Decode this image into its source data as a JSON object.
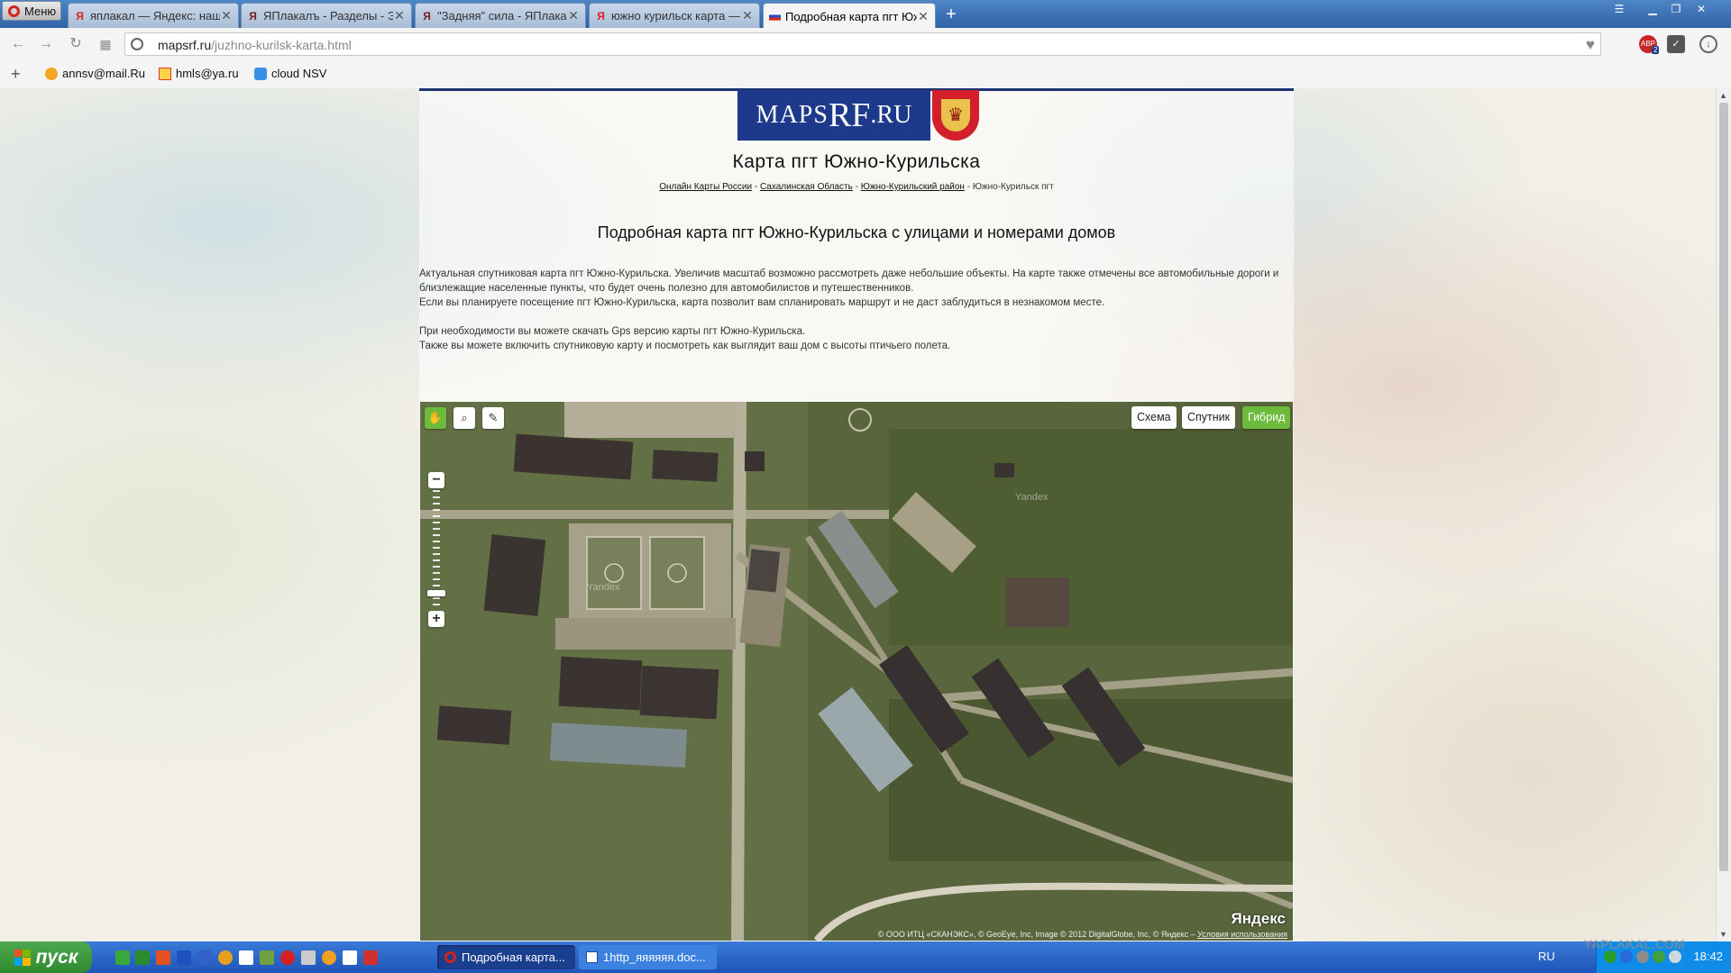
{
  "browser": {
    "menu_label": "Меню",
    "tabs": [
      {
        "label": "яплакал — Яндекс: наш",
        "icon": "yandex-icon"
      },
      {
        "label": "ЯПлакалъ - Разделы - Э",
        "icon": "yaplakal-icon"
      },
      {
        "label": "\"Задняя\" сила - ЯПлака",
        "icon": "yaplakal-icon"
      },
      {
        "label": "южно курильск карта —",
        "icon": "yandex-icon"
      },
      {
        "label": "Подробная карта пгт Юж",
        "icon": "russia-flag-icon"
      }
    ],
    "new_tab": "+",
    "url_host": "mapsrf.ru",
    "url_path": "/juzhno-kurilsk-karta.html",
    "bookmarks": [
      {
        "label": "annsv@mail.Ru",
        "icon": "mailru-icon"
      },
      {
        "label": "hmls@ya.ru",
        "icon": "mail-envelope-icon"
      },
      {
        "label": "cloud NSV",
        "icon": "cloud-icon"
      }
    ],
    "ext_badge": "2"
  },
  "page": {
    "logo": {
      "part1": "MAPS",
      "part2": "RF",
      "part3": ".RU"
    },
    "title": "Карта пгт Южно-Курильска",
    "breadcrumbs": [
      "Онлайн Карты России",
      "Сахалинская Область",
      "Южно-Курильский район",
      "Южно-Курильск пгт"
    ],
    "crumb_sep": " - ",
    "subtitle": "Подробная карта пгт Южно-Курильска с улицами и номерами домов",
    "paragraph1": "Актуальная спутниковая карта пгт Южно-Курильска. Увеличив масштаб возможно рассмотреть даже небольшие объекты. На карте также отмечены все автомобильные дороги и близлежащие населенные пункты, что будет очень полезно для автомобилистов и путешественников.",
    "paragraph2": "Если вы планируете посещение пгт Южно-Курильска, карта позволит вам спланировать маршрут и не даст заблудиться в незнакомом месте.",
    "paragraph3": "При необходимости вы можете скачать Gps версию карты пгт Южно-Курильска.",
    "paragraph4": "Также вы можете включить спутниковую карту и посмотреть как выглядит ваш дом с высоты птичьего полета."
  },
  "map": {
    "layers": [
      {
        "label": "Схема",
        "active": false
      },
      {
        "label": "Спутник",
        "active": false
      },
      {
        "label": "Гибрид",
        "active": true
      }
    ],
    "zoom_in": "+",
    "zoom_out": "−",
    "zoom_level": 0.11,
    "brand": "Яндекс",
    "watermark": "Yandex",
    "copyright": "© ООО ИТЦ «СКАНЭКС», © GeoEye, Inc, Image © 2012 DigitalGlobe, Inc, © Яндекс – ",
    "terms_link": "Условия использования"
  },
  "taskbar": {
    "start_label": "пуск",
    "tasks": [
      {
        "label": "Подробная карта...",
        "active": true
      },
      {
        "label": "1http_яяяяяя.doc...",
        "active": false
      }
    ],
    "lang": "RU",
    "clock": "18:42"
  },
  "watermark_site": "YAPLAKAL.COM"
}
